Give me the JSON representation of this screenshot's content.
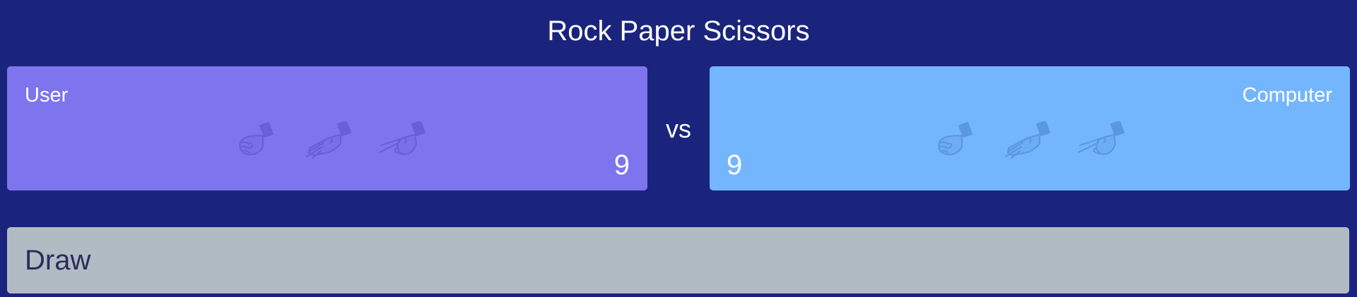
{
  "app": {
    "title": "Rock Paper Scissors",
    "vs_label": "vs"
  },
  "user": {
    "label": "User",
    "score": "9",
    "choices": [
      "rock",
      "paper",
      "scissors"
    ]
  },
  "computer": {
    "label": "Computer",
    "score": "9",
    "choices": [
      "rock",
      "paper",
      "scissors"
    ]
  },
  "result": {
    "text": "Draw"
  },
  "colors": {
    "background": "#1b247d",
    "user_panel": "#7e74ee",
    "computer_panel": "#74b6fe",
    "result_panel": "#b1bbc4",
    "hand_icon_user": "#6a5fd6",
    "hand_icon_computer": "#5b98e0"
  }
}
